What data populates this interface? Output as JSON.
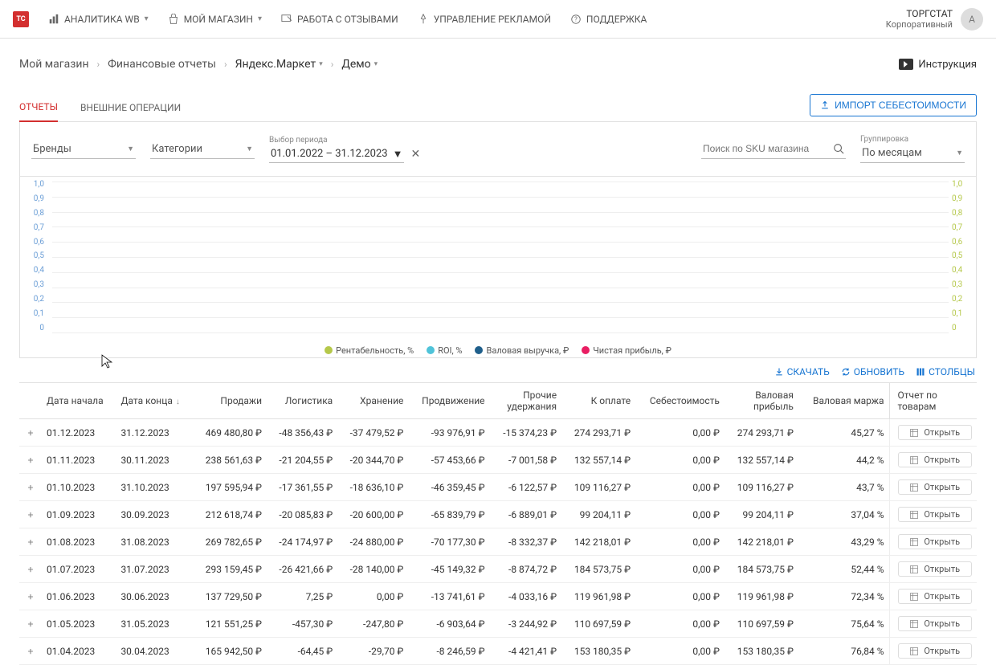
{
  "header": {
    "logo": "ТС",
    "nav": {
      "analytics": "АНАЛИТИКА WB",
      "my_store": "МОЙ МАГАЗИН",
      "reviews": "РАБОТА С ОТЗЫВАМИ",
      "ads": "УПРАВЛЕНИЕ РЕКЛАМОЙ",
      "support": "ПОДДЕРЖКА"
    },
    "company": {
      "name": "ТОРГСТАТ",
      "plan": "Корпоративный"
    },
    "avatar": "A"
  },
  "breadcrumbs": {
    "root": "Мой магазин",
    "section": "Финансовые отчеты",
    "marketplace": "Яндекс.Маркет",
    "store": "Демо",
    "instruction": "Инструкция"
  },
  "tabs": {
    "reports": "ОТЧЕТЫ",
    "external": "ВНЕШНИЕ ОПЕРАЦИИ"
  },
  "import_btn": "ИМПОРТ СЕБЕСТОИМОСТИ",
  "filters": {
    "brands": "Бренды",
    "categories": "Категории",
    "period_label": "Выбор периода",
    "period_value": "01.01.2022 – 31.12.2023",
    "search_placeholder": "Поиск по SKU магазина",
    "group_label": "Группировка",
    "group_value": "По месяцам"
  },
  "chart_data": {
    "type": "line",
    "ylim_left": [
      0,
      1.0
    ],
    "ylim_right": [
      0,
      1.0
    ],
    "ticks_left": [
      "1,0",
      "0,9",
      "0,8",
      "0,7",
      "0,6",
      "0,5",
      "0,4",
      "0,3",
      "0,2",
      "0,1",
      "0"
    ],
    "ticks_right": [
      "1,0",
      "0,9",
      "0,8",
      "0,7",
      "0,6",
      "0,5",
      "0,4",
      "0,3",
      "0,2",
      "0,1",
      "0"
    ],
    "series": [
      {
        "name": "Рентабельность, %",
        "color": "#b5c84a"
      },
      {
        "name": "ROI, %",
        "color": "#4fc3d9"
      },
      {
        "name": "Валовая выручка, ₽",
        "color": "#1f5f8b"
      },
      {
        "name": "Чистая прибыль, ₽",
        "color": "#e91e63"
      }
    ]
  },
  "table_actions": {
    "download": "СКАЧАТЬ",
    "refresh": "ОБНОВИТЬ",
    "columns": "СТОЛБЦЫ"
  },
  "columns": {
    "start": "Дата начала",
    "end": "Дата конца",
    "sales": "Продажи",
    "logistics": "Логистика",
    "storage": "Хранение",
    "promo": "Продвижение",
    "other": "Прочие удержания",
    "to_pay": "К оплате",
    "cost": "Себестоимость",
    "gross_profit": "Валовая прибыль",
    "gross_margin": "Валовая маржа",
    "report": "Отчет по товарам"
  },
  "open_label": "Открыть",
  "rows": [
    {
      "start": "01.12.2023",
      "end": "31.12.2023",
      "sales": "469 480,80 ₽",
      "logistics": "-48 356,43 ₽",
      "storage": "-37 479,52 ₽",
      "promo": "-93 976,91 ₽",
      "other": "-15 374,23 ₽",
      "to_pay": "274 293,71 ₽",
      "cost": "0,00 ₽",
      "gross_profit": "274 293,71 ₽",
      "gross_margin": "45,27 %"
    },
    {
      "start": "01.11.2023",
      "end": "30.11.2023",
      "sales": "238 561,63 ₽",
      "logistics": "-21 204,55 ₽",
      "storage": "-20 344,70 ₽",
      "promo": "-57 453,66 ₽",
      "other": "-7 001,58 ₽",
      "to_pay": "132 557,14 ₽",
      "cost": "0,00 ₽",
      "gross_profit": "132 557,14 ₽",
      "gross_margin": "44,2 %"
    },
    {
      "start": "01.10.2023",
      "end": "31.10.2023",
      "sales": "197 595,94 ₽",
      "logistics": "-17 361,55 ₽",
      "storage": "-18 636,10 ₽",
      "promo": "-46 359,45 ₽",
      "other": "-6 122,57 ₽",
      "to_pay": "109 116,27 ₽",
      "cost": "0,00 ₽",
      "gross_profit": "109 116,27 ₽",
      "gross_margin": "43,7 %"
    },
    {
      "start": "01.09.2023",
      "end": "30.09.2023",
      "sales": "212 618,74 ₽",
      "logistics": "-20 085,83 ₽",
      "storage": "-20 600,00 ₽",
      "promo": "-65 839,79 ₽",
      "other": "-6 889,01 ₽",
      "to_pay": "99 204,11 ₽",
      "cost": "0,00 ₽",
      "gross_profit": "99 204,11 ₽",
      "gross_margin": "37,04 %"
    },
    {
      "start": "01.08.2023",
      "end": "31.08.2023",
      "sales": "269 782,65 ₽",
      "logistics": "-24 174,97 ₽",
      "storage": "-24 880,00 ₽",
      "promo": "-70 177,30 ₽",
      "other": "-8 332,37 ₽",
      "to_pay": "142 218,01 ₽",
      "cost": "0,00 ₽",
      "gross_profit": "142 218,01 ₽",
      "gross_margin": "43,29 %"
    },
    {
      "start": "01.07.2023",
      "end": "31.07.2023",
      "sales": "293 159,45 ₽",
      "logistics": "-26 421,66 ₽",
      "storage": "-28 140,00 ₽",
      "promo": "-45 149,32 ₽",
      "other": "-8 874,72 ₽",
      "to_pay": "184 573,75 ₽",
      "cost": "0,00 ₽",
      "gross_profit": "184 573,75 ₽",
      "gross_margin": "52,44 %"
    },
    {
      "start": "01.06.2023",
      "end": "30.06.2023",
      "sales": "137 729,50 ₽",
      "logistics": "7,25 ₽",
      "storage": "0,00 ₽",
      "promo": "-13 741,61 ₽",
      "other": "-4 033,16 ₽",
      "to_pay": "119 961,98 ₽",
      "cost": "0,00 ₽",
      "gross_profit": "119 961,98 ₽",
      "gross_margin": "72,34 %"
    },
    {
      "start": "01.05.2023",
      "end": "31.05.2023",
      "sales": "121 551,25 ₽",
      "logistics": "-457,30 ₽",
      "storage": "-247,80 ₽",
      "promo": "-6 903,64 ₽",
      "other": "-3 244,92 ₽",
      "to_pay": "110 697,59 ₽",
      "cost": "0,00 ₽",
      "gross_profit": "110 697,59 ₽",
      "gross_margin": "75,64 %"
    },
    {
      "start": "01.04.2023",
      "end": "30.04.2023",
      "sales": "165 942,50 ₽",
      "logistics": "-64,45 ₽",
      "storage": "-29,70 ₽",
      "promo": "-8 246,59 ₽",
      "other": "-4 421,41 ₽",
      "to_pay": "153 180,35 ₽",
      "cost": "0,00 ₽",
      "gross_profit": "153 180,35 ₽",
      "gross_margin": "76,84 %"
    }
  ]
}
